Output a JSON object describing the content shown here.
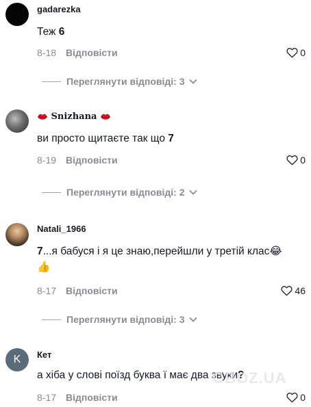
{
  "comments": [
    {
      "username": "gadarezka",
      "text": "Теж ",
      "text_bold": "6",
      "date": "8-18",
      "reply_label": "Відповісти",
      "likes": "0",
      "view_replies": "Переглянути відповіді: 3"
    },
    {
      "username": "Snizhana",
      "text": "ви просто щитаєте так що ",
      "text_bold": "7",
      "date": "8-19",
      "reply_label": "Відповісти",
      "likes": "0",
      "view_replies": "Переглянути відповіді: 2"
    },
    {
      "username": "Natali_1966",
      "text_bold": "7",
      "text": "...я бабуся і я це знаю,перейшли у третій клас",
      "emoji": "😂",
      "emoji2": "👍",
      "date": "8-17",
      "reply_label": "Відповісти",
      "likes": "46",
      "view_replies": "Переглянути відповіді: 3"
    },
    {
      "username": "Кет",
      "avatar_letter": "K",
      "text": "а хіба у слові поїзд буква ї має два звуки",
      "text_bold": "?",
      "date": "8-17",
      "reply_label": "Відповісти",
      "likes": "0"
    }
  ],
  "colors": {
    "text": "#161823",
    "muted": "#8a8b91",
    "avatar_k": "#5c6b7a"
  },
  "watermark": "OBOZ.UA"
}
